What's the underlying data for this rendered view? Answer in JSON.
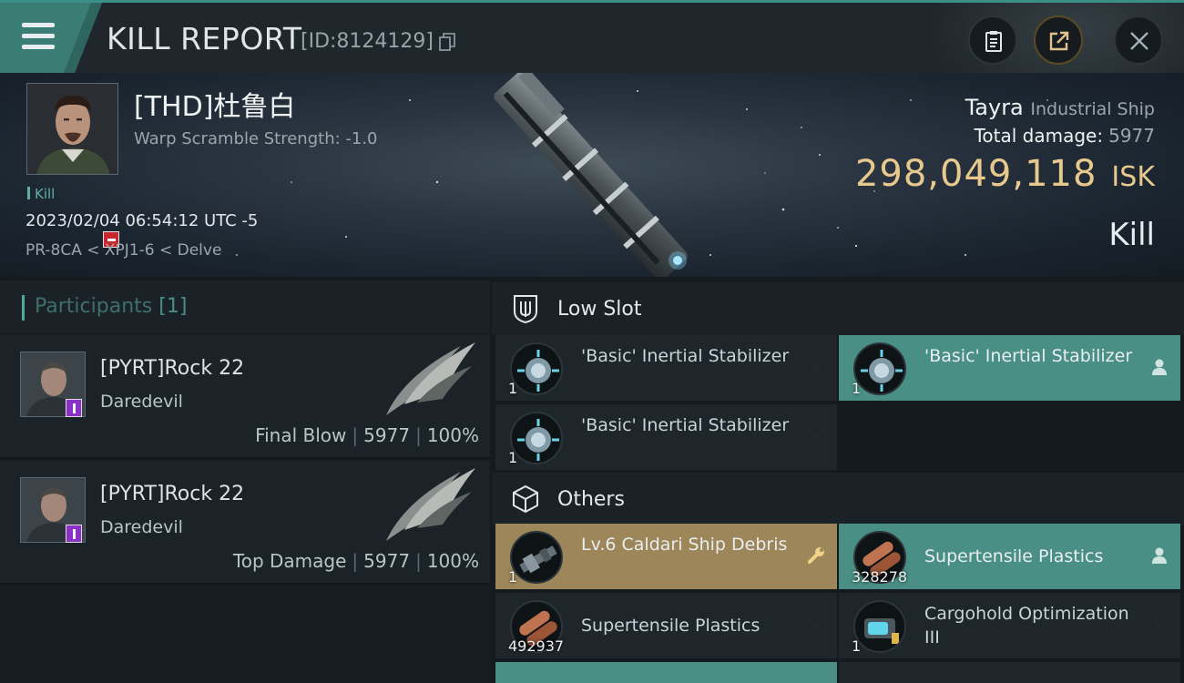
{
  "header": {
    "title": "KILL REPORT",
    "report_id": "[ID:8124129]"
  },
  "victim": {
    "name": "[THD]杜鲁白",
    "warp_scramble": "Warp Scramble Strength: -1.0",
    "tag": "Kill",
    "datetime": "2023/02/04 06:54:12 UTC -5",
    "location": "PR-8CA < XPJ1-6 < Delve",
    "ship_name": "Tayra",
    "ship_class": "Industrial Ship",
    "total_damage_label": "Total damage:",
    "total_damage": "5977",
    "isk_value": "298,049,118",
    "isk_unit": "ISK",
    "result": "Kill"
  },
  "participants": {
    "title": "Participants",
    "count": "[1]",
    "items": [
      {
        "name": "[PYRT]Rock 22",
        "ship": "Daredevil",
        "role": "Final Blow",
        "damage": "5977",
        "percent": "100%"
      },
      {
        "name": "[PYRT]Rock 22",
        "ship": "Daredevil",
        "role": "Top Damage",
        "damage": "5977",
        "percent": "100%"
      }
    ],
    "separator": "|"
  },
  "sections": {
    "low_slot": "Low Slot",
    "others": "Others"
  },
  "low_slot_items": [
    {
      "name": "'Basic' Inertial Stabilizer",
      "qty": "1",
      "status": "destroyed"
    },
    {
      "name": "'Basic' Inertial Stabilizer",
      "qty": "1",
      "status": "dropped"
    },
    {
      "name": "'Basic' Inertial Stabilizer",
      "qty": "1",
      "status": "destroyed"
    }
  ],
  "other_items": [
    {
      "name": "Lv.6 Caldari Ship Debris",
      "qty": "1",
      "status": "special"
    },
    {
      "name": "Supertensile Plastics",
      "qty": "328278",
      "status": "dropped"
    },
    {
      "name": "Supertensile Plastics",
      "qty": "492937",
      "status": "destroyed"
    },
    {
      "name": "Cargohold Optimization III",
      "qty": "1",
      "status": "destroyed"
    }
  ],
  "colors": {
    "accent_teal": "#4a8f85",
    "isk_gold": "#e8c98d",
    "special_gold": "#9d8659",
    "destroyed_bg": "#1e262b"
  }
}
